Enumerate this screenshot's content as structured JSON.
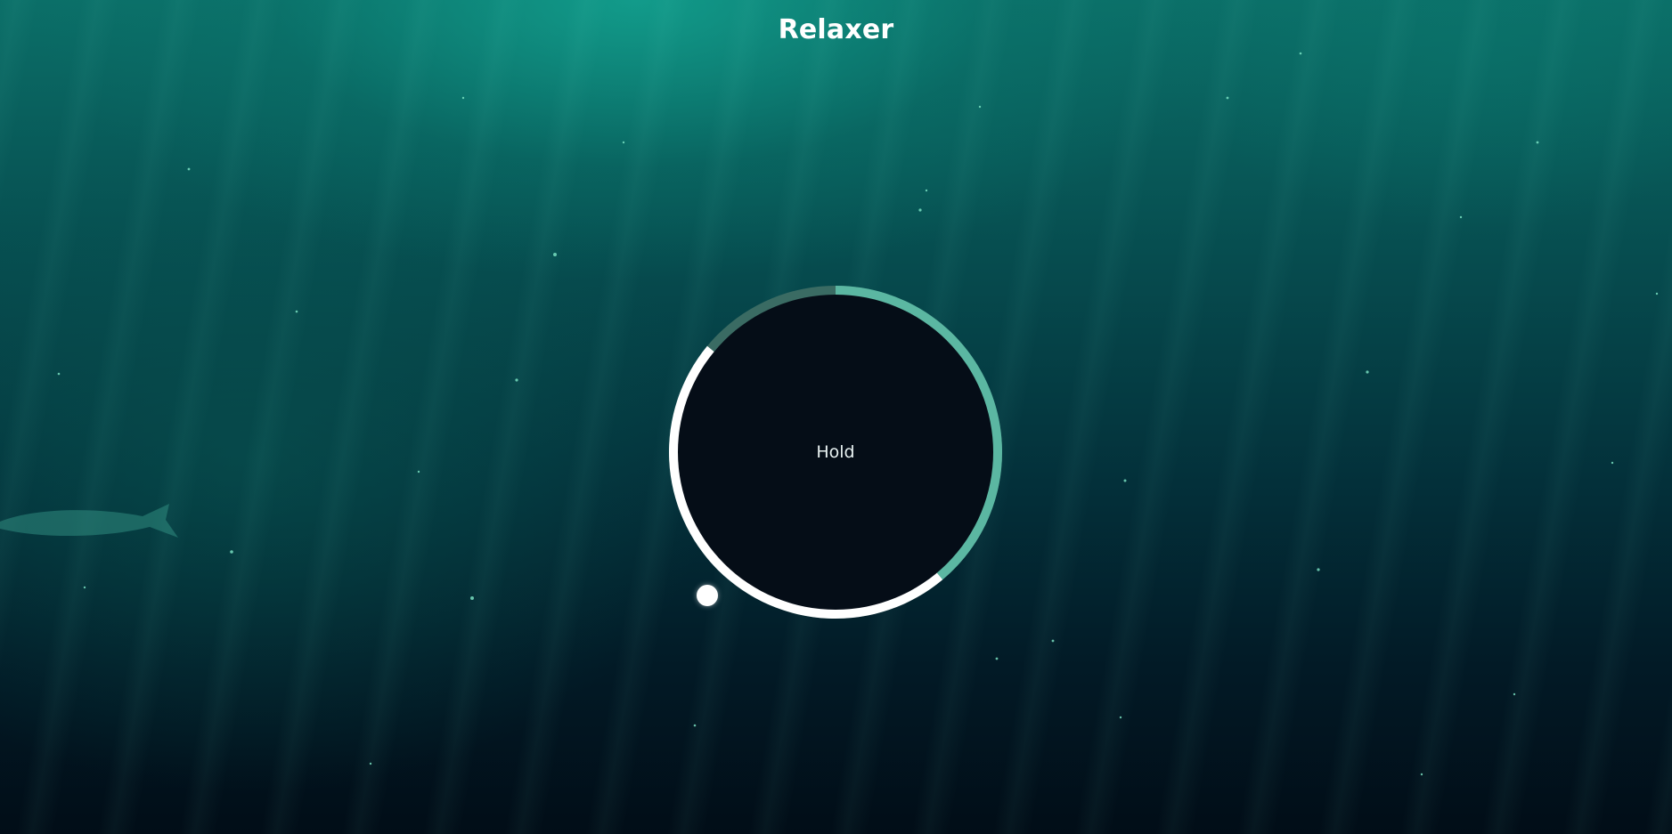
{
  "app": {
    "title": "Relaxer"
  },
  "breathing": {
    "phase_label": "Hold",
    "progress_fraction": 0.86
  },
  "colors": {
    "accent_teal": "#5bb7a2",
    "track_dark": "#3a6b63",
    "hold_segment": "#ffffff",
    "circle_fill": "#050d17",
    "text": "#ffffff"
  }
}
